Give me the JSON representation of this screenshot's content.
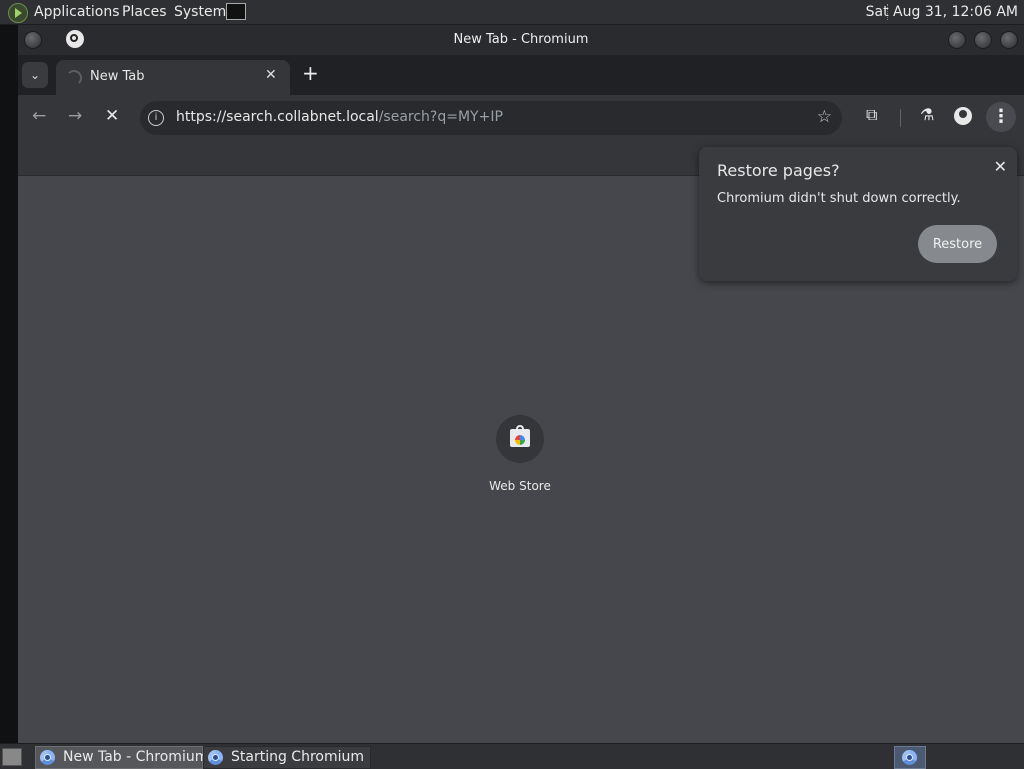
{
  "top_panel": {
    "menus": [
      "Applications",
      "Places",
      "System"
    ],
    "clock": "Sat Aug 31, 12:06 AM"
  },
  "window": {
    "title": "New Tab - Chromium"
  },
  "tab": {
    "title": "New Tab",
    "close_glyph": "✕",
    "new_tab_glyph": "+"
  },
  "toolbar": {
    "back_glyph": "←",
    "forward_glyph": "→",
    "stop_glyph": "✕",
    "url_host": "https://search.collabnet.local",
    "url_path": "/search?q=MY+IP",
    "star_glyph": "☆",
    "menu_glyph": "⋮"
  },
  "content": {
    "shortcut_label": "Web Store"
  },
  "restore_bubble": {
    "title": "Restore pages?",
    "message": "Chromium didn't shut down correctly.",
    "button": "Restore",
    "close_glyph": "✕"
  },
  "taskbar": {
    "tasks": [
      {
        "label": "New Tab - Chromium"
      },
      {
        "label": "Starting Chromium"
      }
    ]
  },
  "colors": {
    "content_bg": "#46474c",
    "toolbar_bg": "#35363a",
    "tabstrip_bg": "#202124",
    "restore_button": "#868a8f"
  }
}
